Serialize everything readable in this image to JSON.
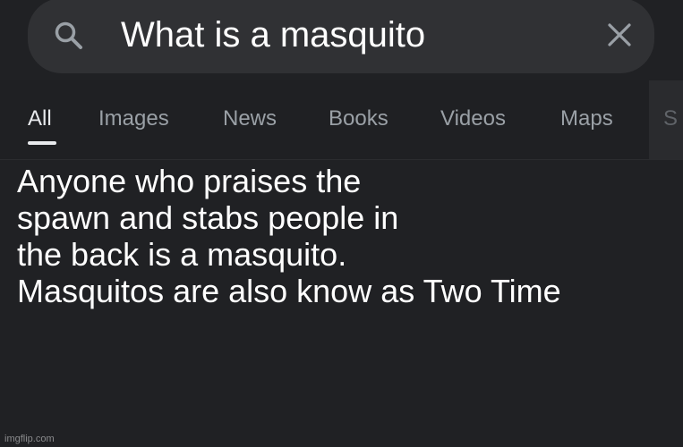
{
  "search": {
    "query": "What is a masquito",
    "search_icon": "search-icon",
    "clear_icon": "close-icon"
  },
  "tabs": [
    {
      "label": "All",
      "active": true
    },
    {
      "label": "Images",
      "active": false
    },
    {
      "label": "News",
      "active": false
    },
    {
      "label": "Books",
      "active": false
    },
    {
      "label": "Videos",
      "active": false
    },
    {
      "label": "Maps",
      "active": false
    },
    {
      "label": "S",
      "active": false
    }
  ],
  "answer": {
    "lines": [
      "Anyone who praises the",
      "spawn and stabs people in",
      "the back is a masquito.",
      "Masquitos are also know as Two Time"
    ]
  },
  "watermark": "imgflip.com",
  "colors": {
    "background": "#202124",
    "search_bar": "#303134",
    "tab_inactive": "#9aa0a6",
    "tab_active": "#e8eaed"
  }
}
